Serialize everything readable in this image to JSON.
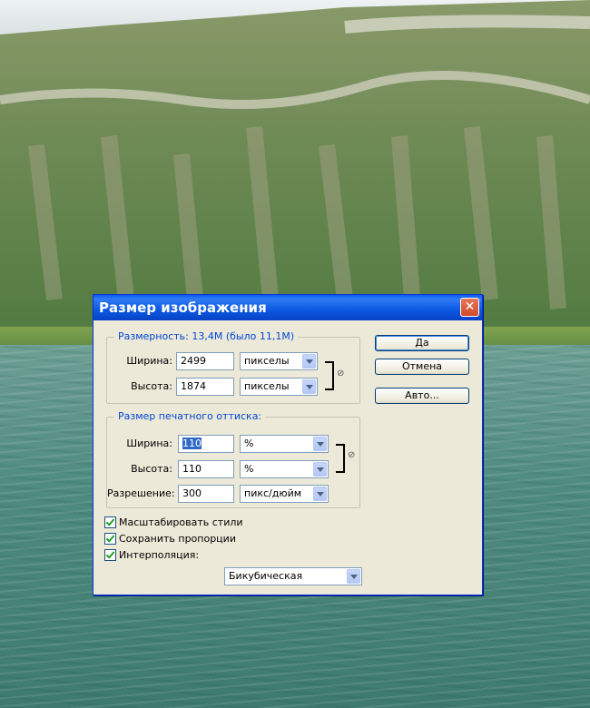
{
  "dialog": {
    "title": "Размер изображения",
    "close_icon": "close-icon"
  },
  "pixel_dimensions": {
    "legend": "Размерность:  13,4M (было 11,1M)",
    "width_label": "Ширина:",
    "width_value": "2499",
    "width_unit": "пикселы",
    "height_label": "Высота:",
    "height_value": "1874",
    "height_unit": "пикселы"
  },
  "document_size": {
    "legend": "Размер печатного оттиска:",
    "width_label": "Ширина:",
    "width_value": "110",
    "width_unit": "%",
    "height_label": "Высота:",
    "height_value": "110",
    "height_unit": "%",
    "resolution_label": "Разрешение:",
    "resolution_value": "300",
    "resolution_unit": "пикс/дюйм"
  },
  "buttons": {
    "ok": "Да",
    "cancel": "Отмена",
    "auto": "Авто..."
  },
  "options": {
    "scale_styles": "Масштабировать стили",
    "constrain_proportions": "Сохранить пропорции",
    "resample": "Интерполяция:",
    "resample_method": "Бикубическая"
  }
}
